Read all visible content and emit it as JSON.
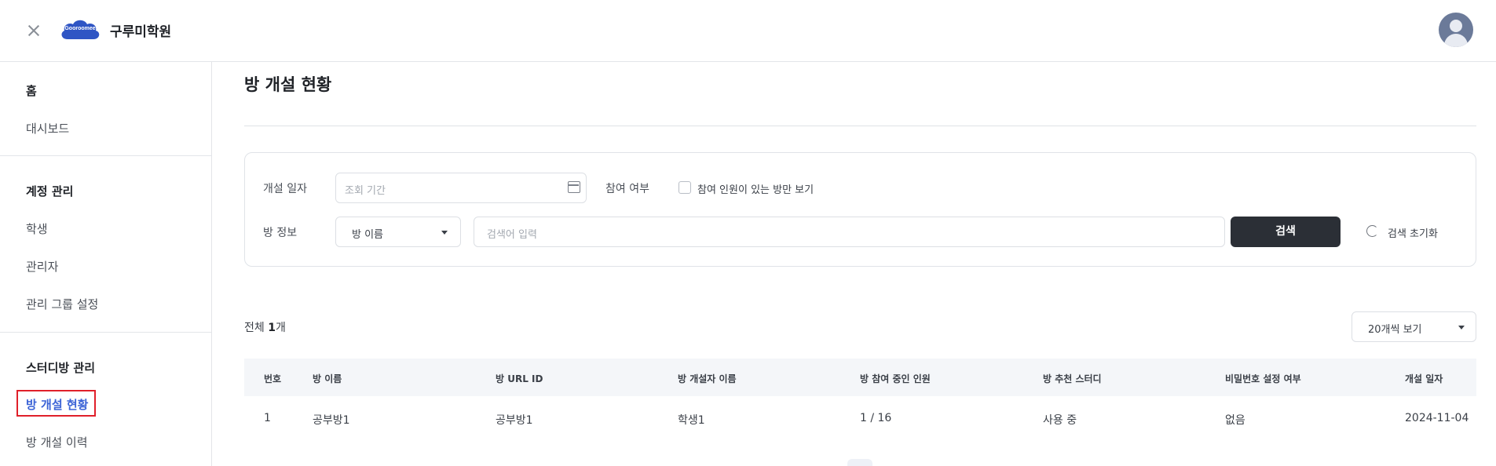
{
  "header": {
    "logo_text": "Gooroomee",
    "academy_name": "구루미학원",
    "close_icon": "close-icon",
    "avatar_icon": "user-avatar-icon"
  },
  "sidebar": {
    "home_heading": "홈",
    "dashboard": "대시보드",
    "account_heading": "계정 관리",
    "students": "학생",
    "admins": "관리자",
    "admin_group": "관리 그룹 설정",
    "study_heading": "스터디방 관리",
    "room_status": "방 개설 현황",
    "room_history": "방 개설 이력"
  },
  "main": {
    "page_title": "방 개설 현황",
    "filters": {
      "date_label": "개설 일자",
      "date_placeholder": "조회 기간",
      "participation_label": "참여 여부",
      "participation_checkbox": "참여 인원이 있는 방만 보기",
      "room_info_label": "방 정보",
      "room_select_value": "방 이름",
      "search_placeholder": "검색어 입력",
      "search_button": "검색",
      "reset_button": "검색 초기화"
    },
    "total_prefix": "전체 ",
    "total_count": "1",
    "total_suffix": "개",
    "per_page": "20개씩 보기",
    "table": {
      "headers": [
        "번호",
        "방 이름",
        "방 URL ID",
        "방 개설자 이름",
        "방 참여 중인 인원",
        "방 추천 스터디",
        "비밀번호 설정 여부",
        "개설 일자"
      ],
      "rows": [
        [
          "1",
          "공부방1",
          "공부방1",
          "학생1",
          "1 / 16",
          "사용 중",
          "없음",
          "2024-11-04"
        ]
      ]
    }
  },
  "colors": {
    "accent": "#3b63d6",
    "highlight_box": "#e0202a",
    "primary_button": "#2b2f36"
  }
}
